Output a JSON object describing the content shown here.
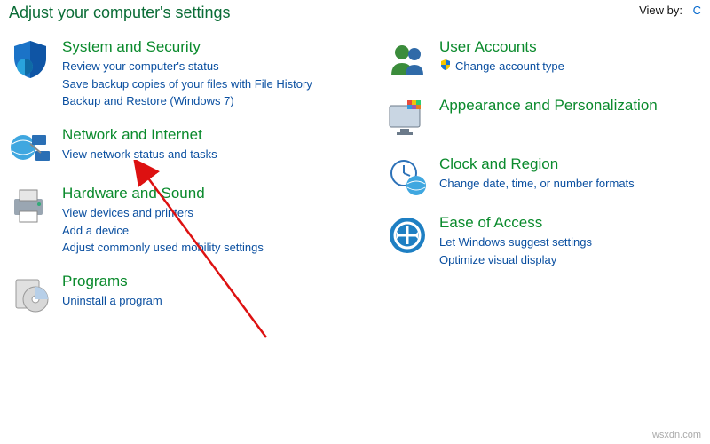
{
  "header": {
    "title": "Adjust your computer's settings",
    "viewby_label": "View by:",
    "viewby_value": "C"
  },
  "left": [
    {
      "title": "System and Security",
      "links": [
        "Review your computer's status",
        "Save backup copies of your files with File History",
        "Backup and Restore (Windows 7)"
      ]
    },
    {
      "title": "Network and Internet",
      "links": [
        "View network status and tasks"
      ]
    },
    {
      "title": "Hardware and Sound",
      "links": [
        "View devices and printers",
        "Add a device",
        "Adjust commonly used mobility settings"
      ]
    },
    {
      "title": "Programs",
      "links": [
        "Uninstall a program"
      ]
    }
  ],
  "right": [
    {
      "title": "User Accounts",
      "links": [
        "Change account type"
      ],
      "link_shield": true
    },
    {
      "title": "Appearance and Personalization",
      "links": []
    },
    {
      "title": "Clock and Region",
      "links": [
        "Change date, time, or number formats"
      ]
    },
    {
      "title": "Ease of Access",
      "links": [
        "Let Windows suggest settings",
        "Optimize visual display"
      ]
    }
  ],
  "watermark": "wsxdn.com"
}
